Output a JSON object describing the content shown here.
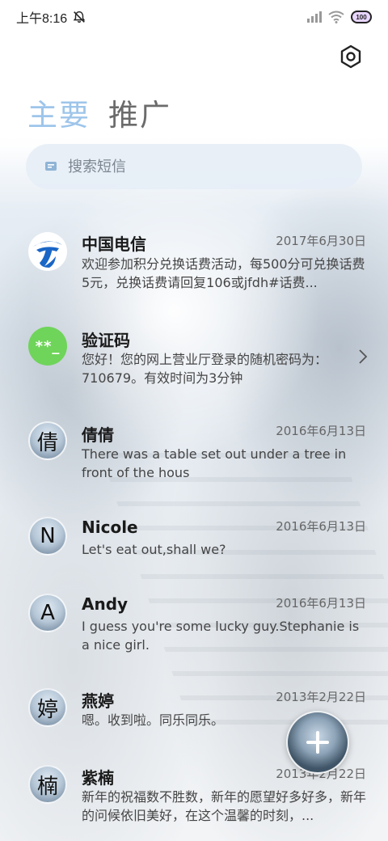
{
  "status_bar": {
    "time": "上午8:16",
    "battery_label": "100"
  },
  "tabs": [
    {
      "label": "主要",
      "active": true
    },
    {
      "label": "推广",
      "active": false
    }
  ],
  "search": {
    "placeholder": "搜索短信"
  },
  "conversations": [
    {
      "name": "中国电信",
      "date": "2017年6月30日",
      "preview": "欢迎参加积分兑换话费活动，每500分可兑换话费5元，兑换话费请回复106或jfdh#话费...",
      "avatar": "telecom-logo"
    },
    {
      "name": "验证码",
      "date": "",
      "preview": "您好！您的网上营业厅登录的随机密码为：710679。有效时间为3分钟",
      "avatar_text": "**_"
    },
    {
      "name": "倩倩",
      "date": "2016年6月13日",
      "preview": "There was a table set out under a tree in front of the hous",
      "avatar_text": "倩"
    },
    {
      "name": "Nicole",
      "date": "2016年6月13日",
      "preview": "Let's eat out,shall we?",
      "avatar_text": "N"
    },
    {
      "name": "Andy",
      "date": "2016年6月13日",
      "preview": "I guess you're some lucky guy.Stephanie is a nice girl.",
      "avatar_text": "A"
    },
    {
      "name": "燕婷",
      "date": "2013年2月22日",
      "preview": "嗯。收到啦。同乐同乐。",
      "avatar_text": "婷"
    },
    {
      "name": "紫楠",
      "date": "2013年2月22日",
      "preview": "新年的祝福数不胜数，新年的愿望好多好多，新年的问候依旧美好，在这个温馨的时刻，...",
      "avatar_text": "楠"
    }
  ],
  "colors": {
    "active_tab": "#9ec5ea",
    "inactive_tab": "#6b6b6b",
    "code_avatar": "#6fd45a",
    "telecom_blue": "#1a66c6"
  },
  "icons": {
    "settings": "hexagon-gear-icon",
    "search": "message-search-icon",
    "fab": "plus-icon",
    "mute": "bell-off-icon",
    "chevron": "chevron-right-icon"
  }
}
